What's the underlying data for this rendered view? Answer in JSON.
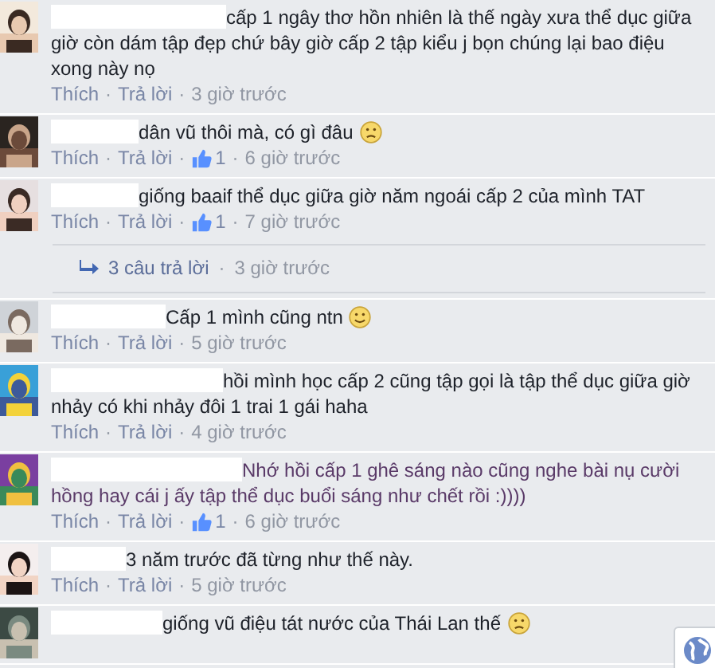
{
  "comments": [
    {
      "kind": "plain",
      "avatar": {
        "kind": "picture"
      },
      "text": "cấp 1 ngây thơ hồn nhiên là thế ngày xưa thể dục giữa giờ còn dám tập đẹp chứ bây giờ cấp 2 tập kiểu j bọn chúng lại bao điệu xong này nọ",
      "actions": [
        {
          "kind": "link",
          "text": "Thích"
        },
        {
          "kind": "dot",
          "text": "·"
        },
        {
          "kind": "link",
          "text": "Trả lời"
        },
        {
          "kind": "dot",
          "text": "·"
        },
        {
          "kind": "time",
          "text": "3 giờ trước"
        }
      ]
    },
    {
      "kind": "frown",
      "avatar": {
        "kind": "picture"
      },
      "text": "dân vũ thôi mà, có gì đâu",
      "actions": [
        {
          "kind": "link",
          "text": "Thích"
        },
        {
          "kind": "dot",
          "text": "·"
        },
        {
          "kind": "link",
          "text": "Trả lời"
        },
        {
          "kind": "dot",
          "text": "·"
        },
        {
          "kind": "likes",
          "text": "1"
        },
        {
          "kind": "dot",
          "text": "·"
        },
        {
          "kind": "time",
          "text": "6 giờ trước"
        }
      ]
    },
    {
      "kind": "plain",
      "avatar": {
        "kind": "picture"
      },
      "text": "giống baaif thể dục giữa giờ năm ngoái cấp 2 của mình TAT",
      "actions": [
        {
          "kind": "link",
          "text": "Thích"
        },
        {
          "kind": "dot",
          "text": "·"
        },
        {
          "kind": "link",
          "text": "Trả lời"
        },
        {
          "kind": "dot",
          "text": "·"
        },
        {
          "kind": "likes",
          "text": "1"
        },
        {
          "kind": "dot",
          "text": "·"
        },
        {
          "kind": "time",
          "text": "7 giờ trước"
        }
      ],
      "replies": {
        "label": "3 câu trả lời",
        "separator": "·",
        "time": "3 giờ trước"
      }
    },
    {
      "kind": "smile",
      "avatar": {
        "kind": "picture"
      },
      "text": "Cấp 1 mình cũng ntn",
      "actions": [
        {
          "kind": "link",
          "text": "Thích"
        },
        {
          "kind": "dot",
          "text": "·"
        },
        {
          "kind": "link",
          "text": "Trả lời"
        },
        {
          "kind": "dot",
          "text": "·"
        },
        {
          "kind": "time",
          "text": "5 giờ trước"
        }
      ]
    },
    {
      "kind": "plain",
      "avatar": {
        "kind": "picture"
      },
      "text": "hồi mình học cấp 2 cũng tập gọi là tập thể dục giữa giờ nhảy có khi nhảy đôi 1 trai 1 gái haha",
      "actions": [
        {
          "kind": "link",
          "text": "Thích"
        },
        {
          "kind": "dot",
          "text": "·"
        },
        {
          "kind": "link",
          "text": "Trả lời"
        },
        {
          "kind": "dot",
          "text": "·"
        },
        {
          "kind": "time",
          "text": "4 giờ trước"
        }
      ]
    },
    {
      "kind": "plain",
      "avatar": {
        "kind": "picture"
      },
      "text": "Nhớ hồi cấp 1 ghê sáng nào cũng nghe bài nụ cười hồng hay cái j ấy tập thể dục buổi sáng như chết rồi :))))",
      "visited": true,
      "actions": [
        {
          "kind": "link",
          "text": "Thích"
        },
        {
          "kind": "dot",
          "text": "·"
        },
        {
          "kind": "link",
          "text": "Trả lời"
        },
        {
          "kind": "dot",
          "text": "·"
        },
        {
          "kind": "likes",
          "text": "1"
        },
        {
          "kind": "dot",
          "text": "·"
        },
        {
          "kind": "time",
          "text": "6 giờ trước"
        }
      ]
    },
    {
      "kind": "plain",
      "avatar": {
        "kind": "picture"
      },
      "text": "3 năm trước đã từng như thế này.",
      "actions": [
        {
          "kind": "link",
          "text": "Thích"
        },
        {
          "kind": "dot",
          "text": "·"
        },
        {
          "kind": "link",
          "text": "Trả lời"
        },
        {
          "kind": "dot",
          "text": "·"
        },
        {
          "kind": "time",
          "text": "5 giờ trước"
        }
      ]
    },
    {
      "kind": "frown",
      "avatar": {
        "kind": "picture"
      },
      "text": "giống vũ điệu tát nước của Thái Lan thế"
    }
  ]
}
